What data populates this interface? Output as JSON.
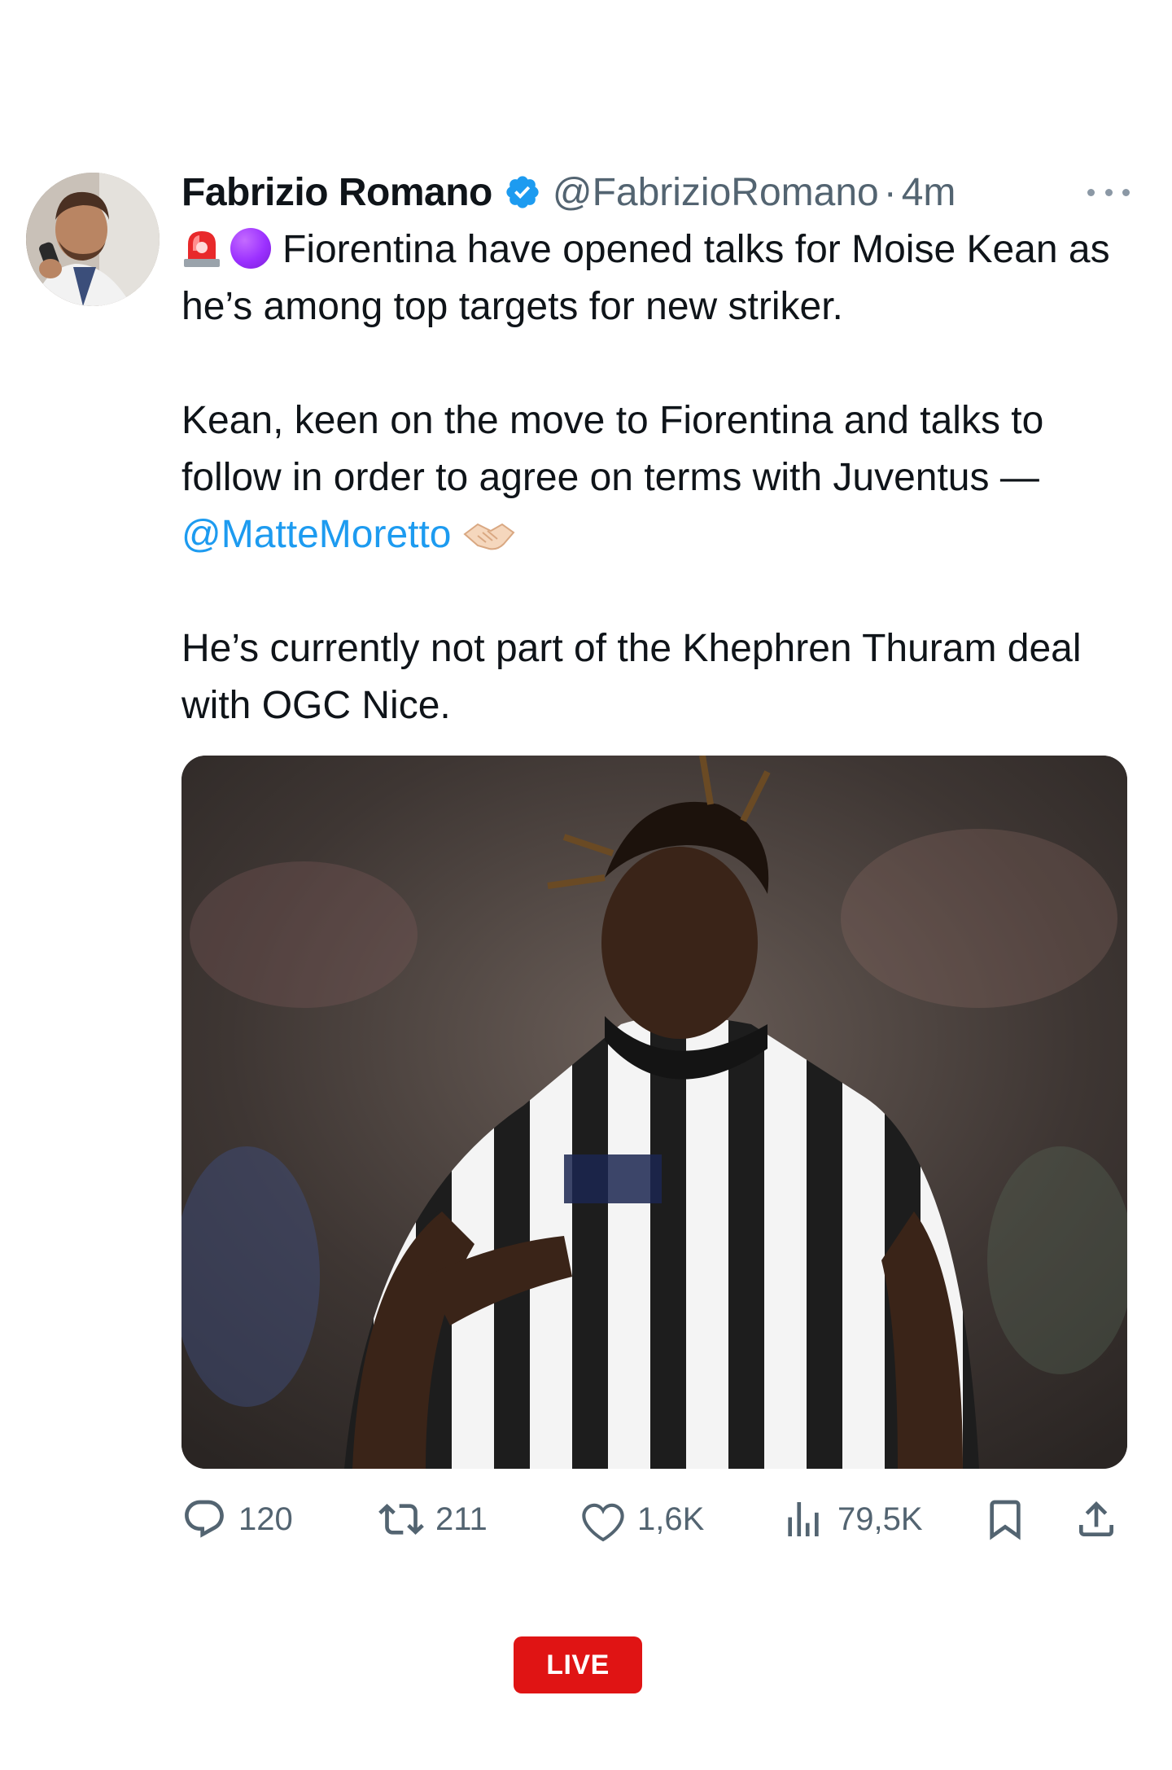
{
  "author": {
    "display_name": "Fabrizio Romano",
    "handle": "@FabrizioRomano",
    "separator": "·",
    "time": "4m",
    "verified": true
  },
  "icons": {
    "verified": "verified-badge-icon",
    "more": "more-options-icon",
    "emoji_1": "police-siren-emoji",
    "emoji_2": "purple-circle-emoji",
    "emoji_3": "handshake-emoji"
  },
  "tweet": {
    "para1_text": "Fiorentina have opened talks for Moise Kean as he’s among top targets for new striker.",
    "para2_text": "Kean, keen on the move to Fiorentina and talks to follow in order to agree on terms with Juventus —",
    "para2_mention": "@MatteMoretto",
    "para3_text": "He’s currently not part of the Khephren Thuram deal with OGC Nice."
  },
  "actions": {
    "replies": "120",
    "retweets": "211",
    "likes": "1,6K",
    "views": "79,5K"
  },
  "live": {
    "label": "LIVE"
  },
  "colors": {
    "accent": "#1d9bf0",
    "muted": "#536471",
    "live_red": "#e01414"
  }
}
